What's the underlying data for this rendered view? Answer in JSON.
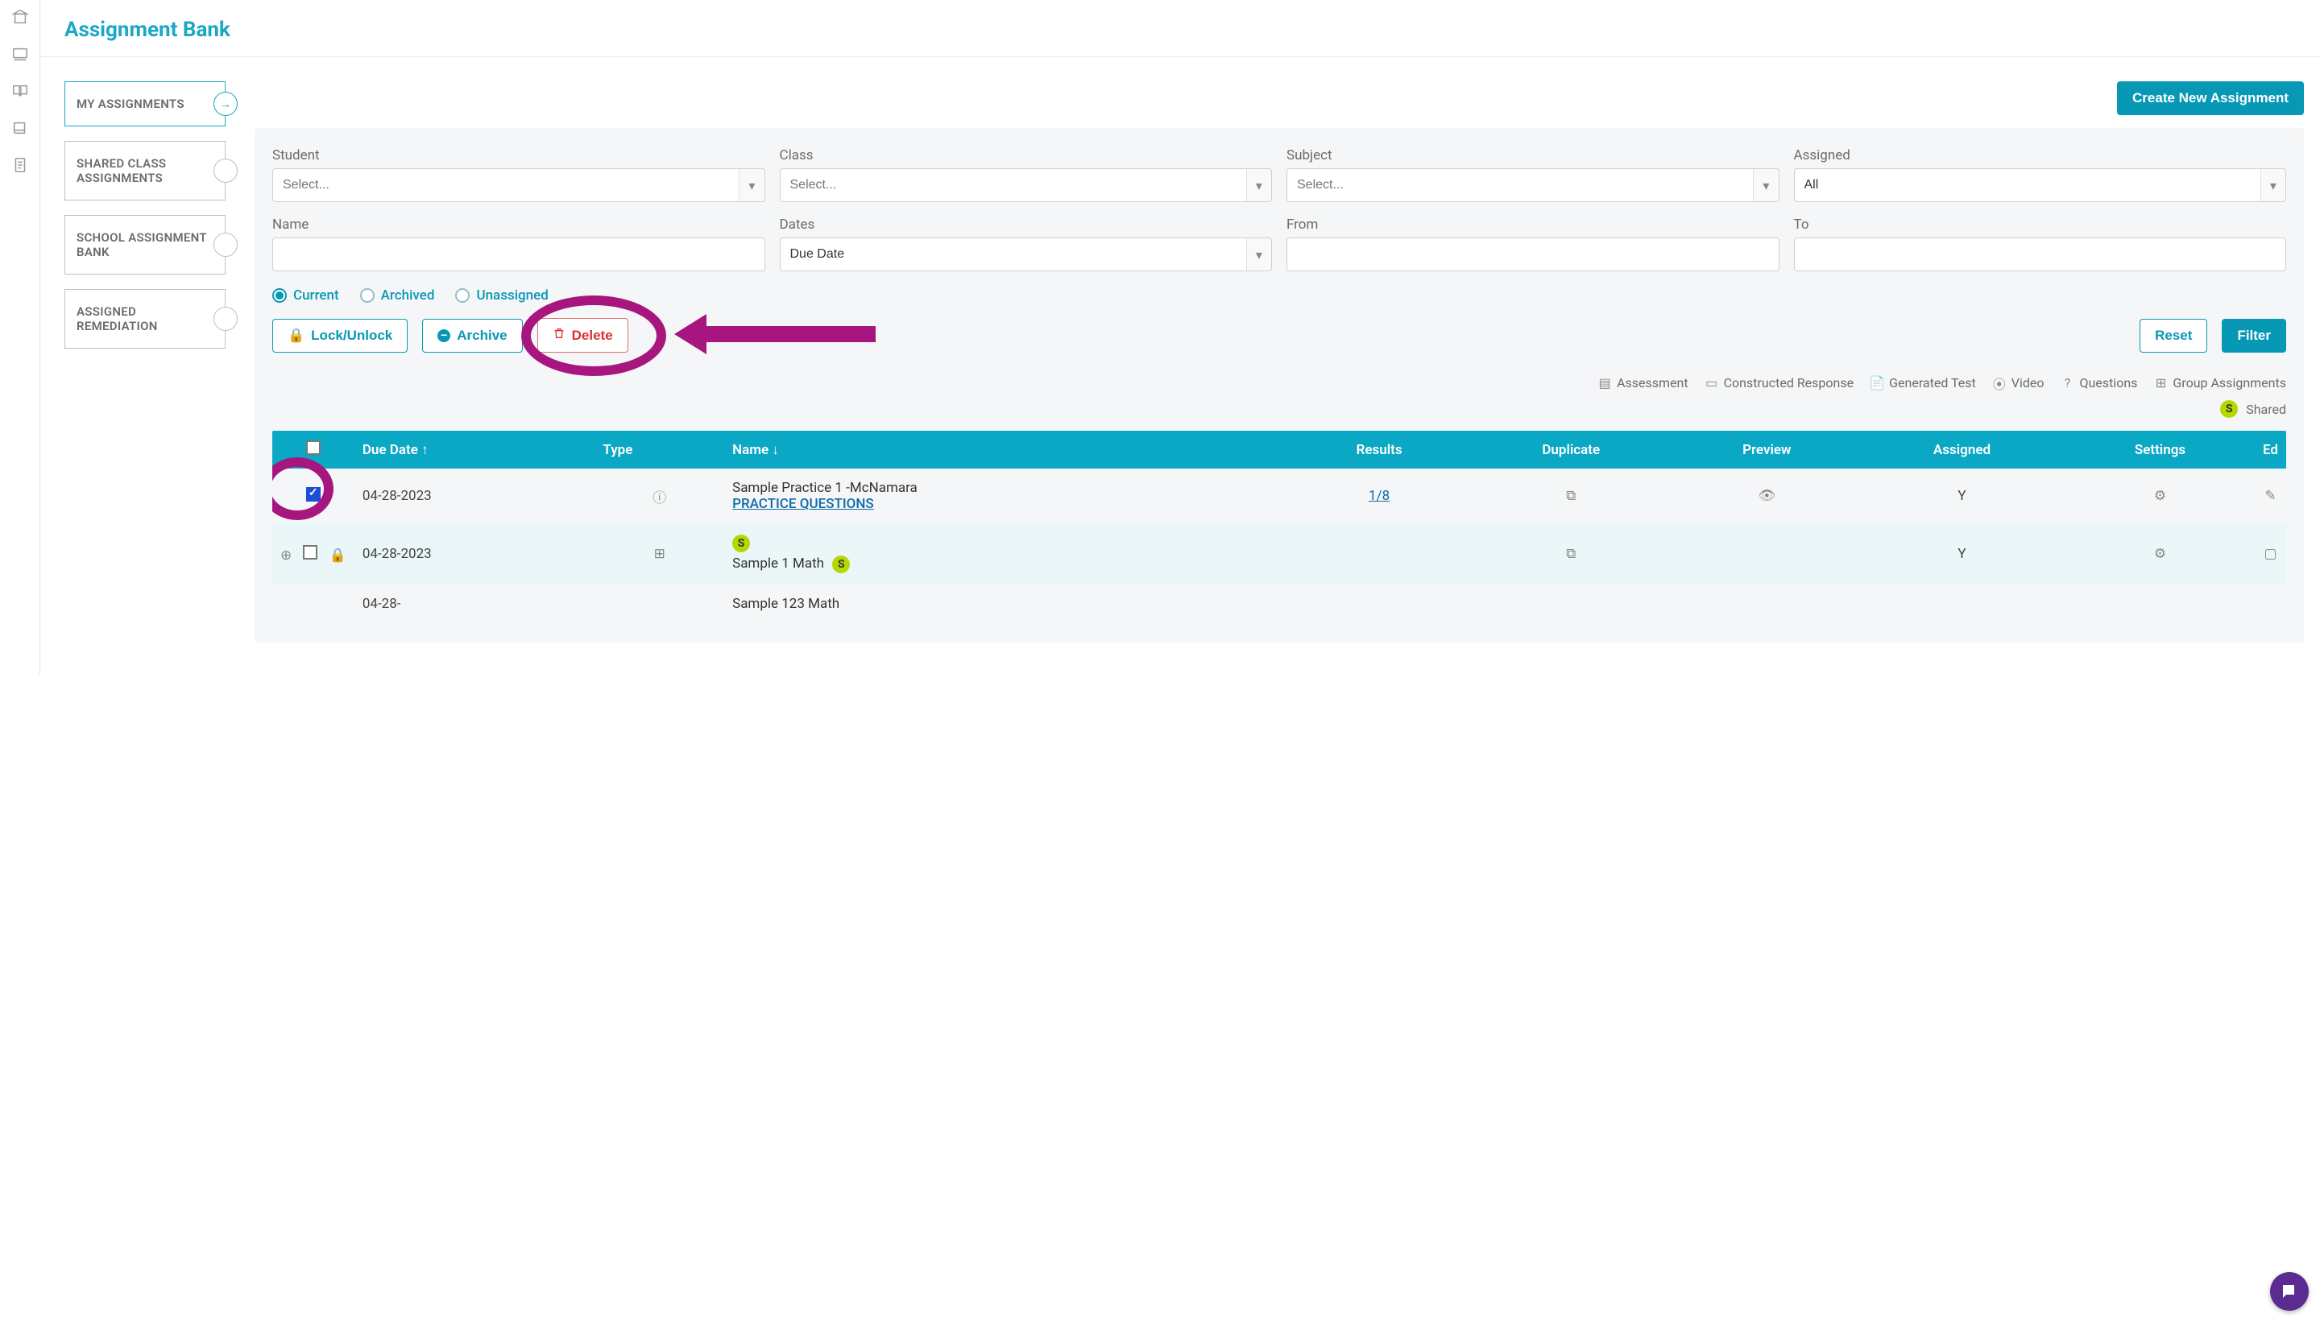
{
  "page": {
    "title": "Assignment Bank"
  },
  "sideTabs": [
    {
      "label": "MY ASSIGNMENTS",
      "active": true
    },
    {
      "label": "SHARED CLASS ASSIGNMENTS",
      "active": false
    },
    {
      "label": "SCHOOL ASSIGNMENT BANK",
      "active": false
    },
    {
      "label": "ASSIGNED REMEDIATION",
      "active": false
    }
  ],
  "buttons": {
    "create": "Create New Assignment",
    "lock": "Lock/Unlock",
    "archive": "Archive",
    "delete": "Delete",
    "reset": "Reset",
    "filter": "Filter"
  },
  "filters": {
    "studentLabel": "Student",
    "studentPlaceholder": "Select...",
    "classLabel": "Class",
    "classPlaceholder": "Select...",
    "subjectLabel": "Subject",
    "subjectPlaceholder": "Select...",
    "assignedLabel": "Assigned",
    "assignedValue": "All",
    "nameLabel": "Name",
    "datesLabel": "Dates",
    "datesValue": "Due Date",
    "fromLabel": "From",
    "toLabel": "To"
  },
  "radios": {
    "current": "Current",
    "archived": "Archived",
    "unassigned": "Unassigned",
    "selected": "current"
  },
  "legend": {
    "assessment": "Assessment",
    "constructed": "Constructed Response",
    "generated": "Generated Test",
    "video": "Video",
    "questions": "Questions",
    "group": "Group Assignments",
    "shared": "Shared",
    "sharedBadge": "S"
  },
  "table": {
    "headers": {
      "dueDate": "Due Date",
      "type": "Type",
      "name": "Name",
      "results": "Results",
      "duplicate": "Duplicate",
      "preview": "Preview",
      "assigned": "Assigned",
      "settings": "Settings",
      "edit": "Ed"
    },
    "rows": [
      {
        "checked": true,
        "dueDate": "04-28-2023",
        "typeIcon": "questions",
        "nameLine1": "Sample Practice 1 -McNamara",
        "nameLine2": "PRACTICE QUESTIONS",
        "shared": false,
        "results": "1/8",
        "assigned": "Y",
        "expand": false
      },
      {
        "checked": false,
        "dueDate": "04-28-2023",
        "typeIcon": "group",
        "nameLine1": "Sample 1 Math",
        "nameLine2": "",
        "shared": true,
        "sharedBadgeTop": "S",
        "sharedBadgeInline": "S",
        "results": "",
        "assigned": "Y",
        "expand": true
      },
      {
        "checked": false,
        "dueDate": "04-28-",
        "typeIcon": "",
        "nameLine1": "Sample 123 Math",
        "nameLine2": "",
        "shared": false,
        "results": "",
        "assigned": "",
        "expand": false
      }
    ]
  }
}
